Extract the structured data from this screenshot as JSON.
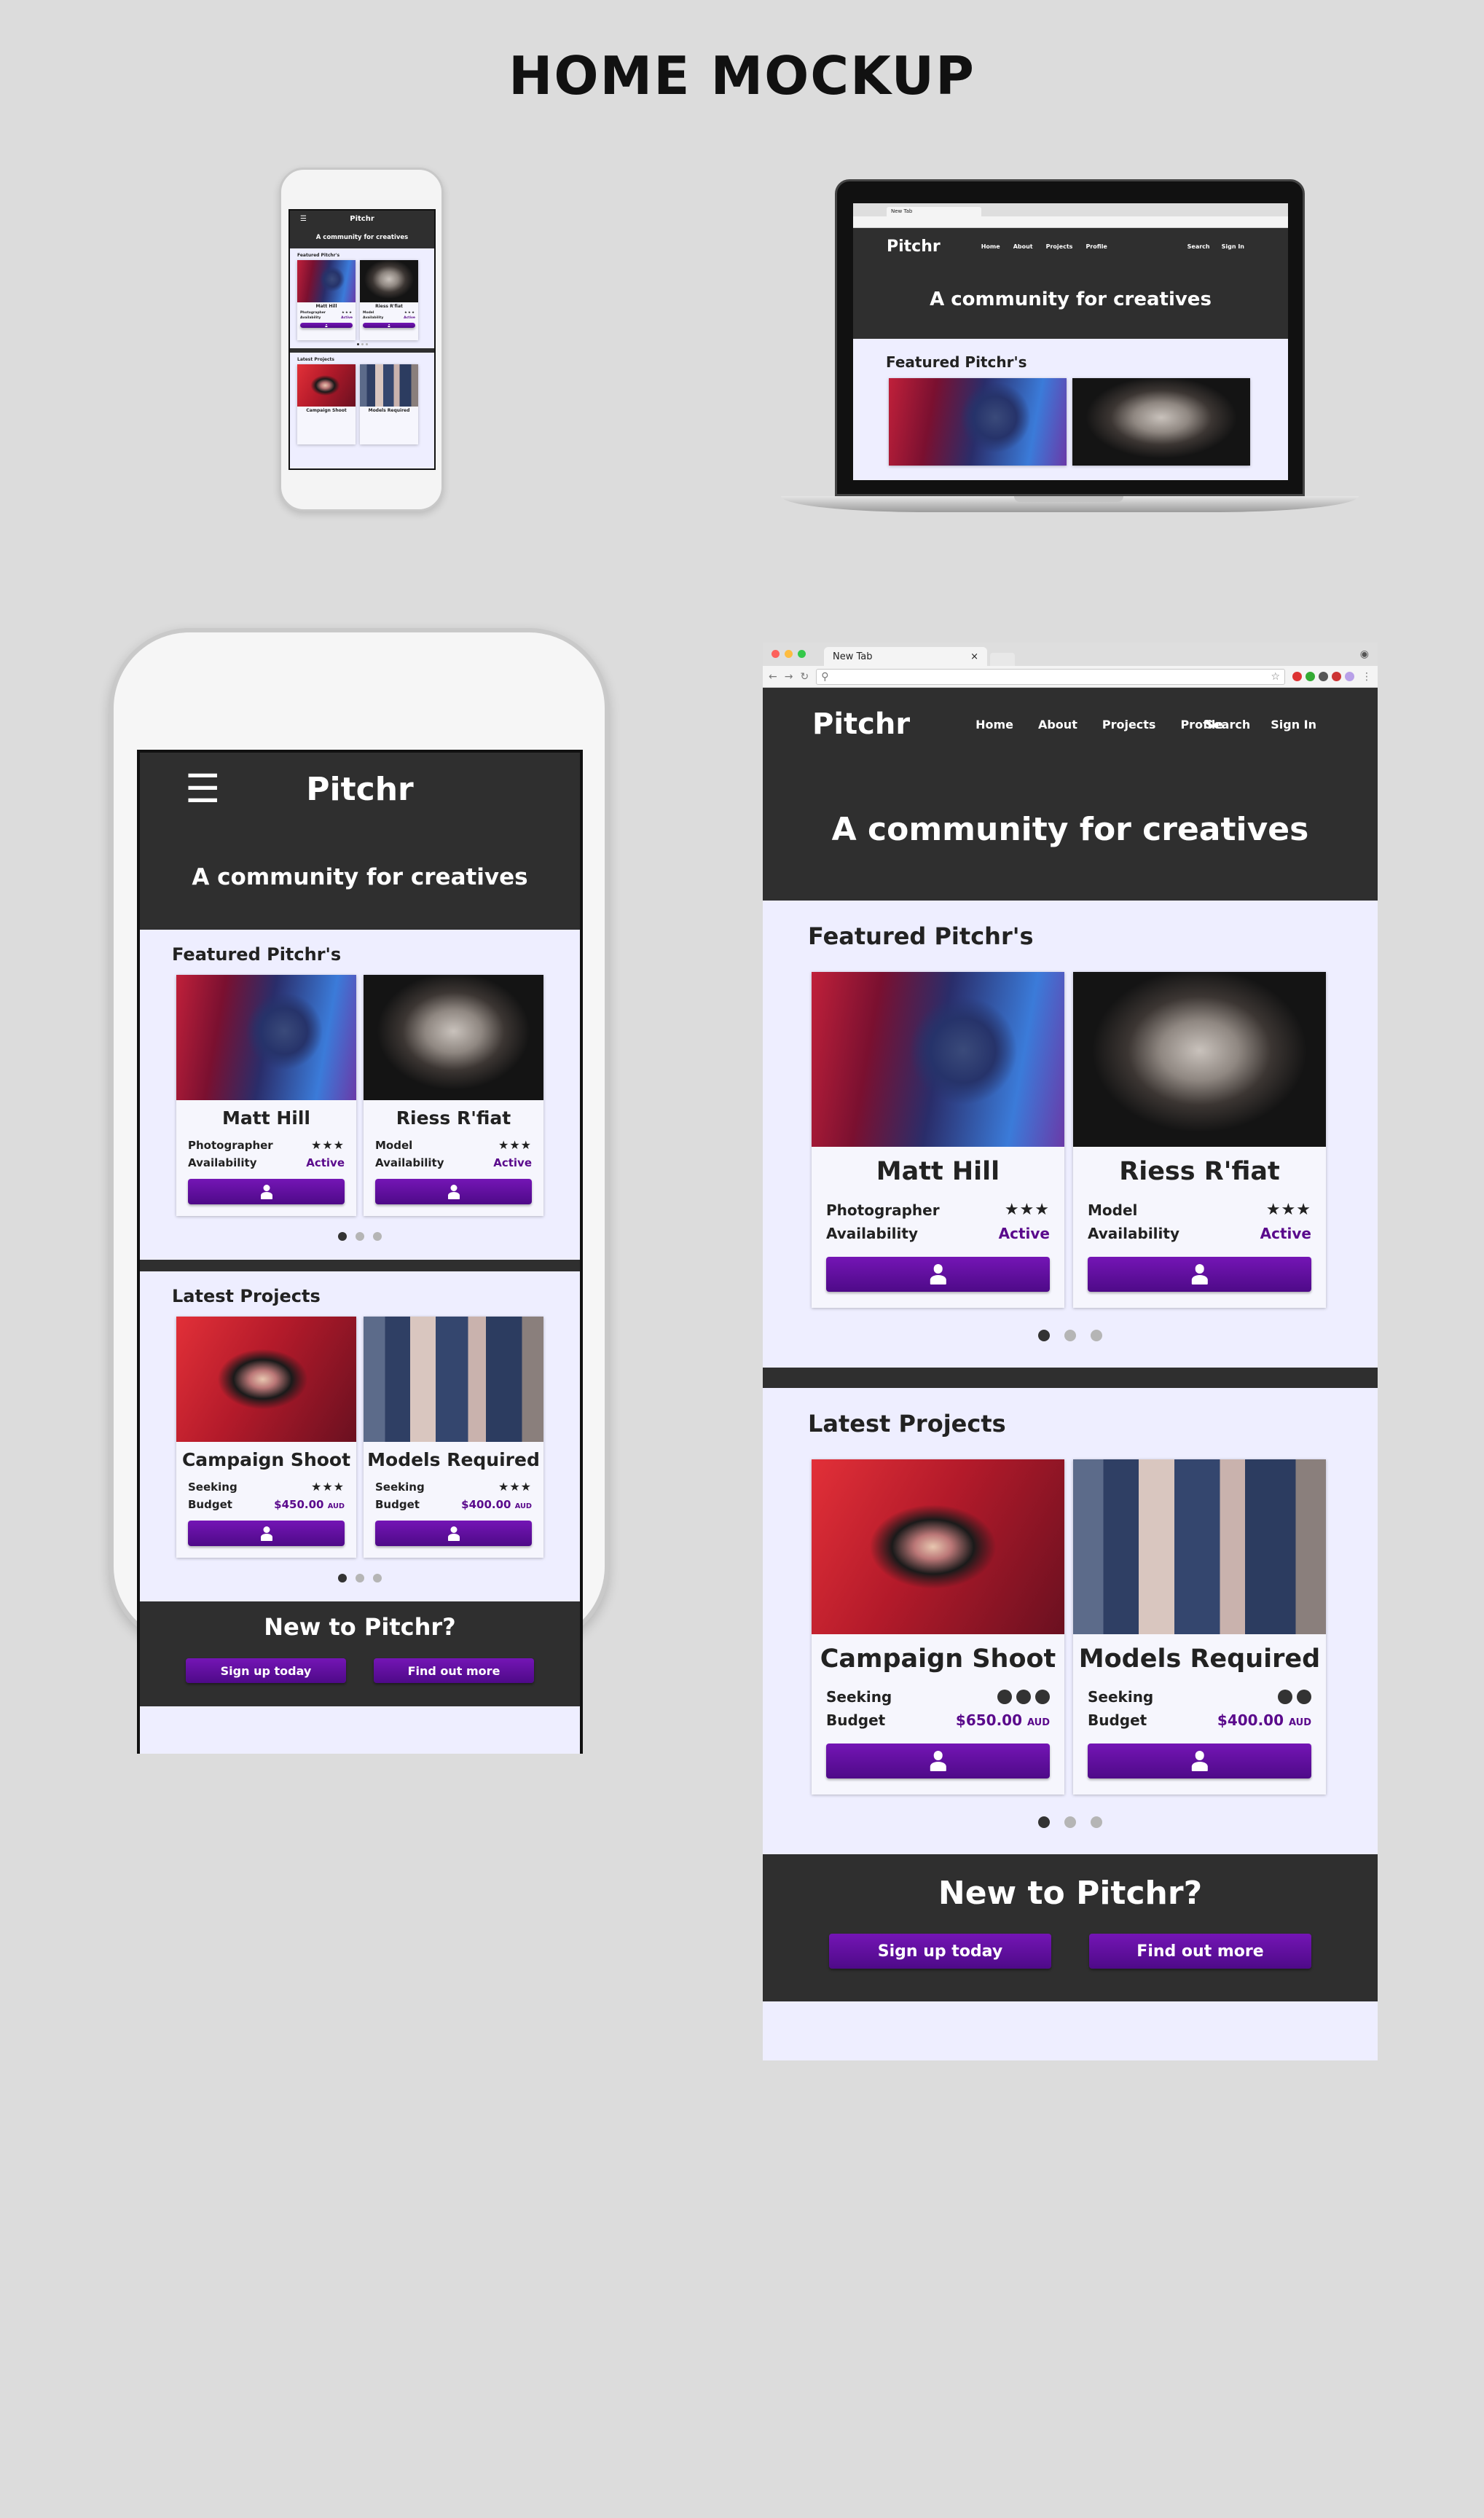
{
  "page_title": "HOME MOCKUP",
  "brand": "Pitchr",
  "nav": {
    "links": [
      "Home",
      "About",
      "Projects",
      "Profile"
    ],
    "search": "Search",
    "signin": "Sign In"
  },
  "hero_text": "A community for creatives",
  "featured": {
    "title": "Featured Pitchr's",
    "cards": [
      {
        "name": "Matt Hill",
        "role": "Photographer",
        "rating_stars": 3,
        "availability_label": "Availability",
        "availability": "Active"
      },
      {
        "name": "Riess R'fiat",
        "role": "Model",
        "rating_stars": 3,
        "availability_label": "Availability",
        "availability": "Active"
      }
    ]
  },
  "projects": {
    "title": "Latest Projects",
    "cards": [
      {
        "name": "Campaign Shoot",
        "seeking_label": "Seeking",
        "budget_label": "Budget",
        "budget_phone": "$450.00",
        "budget_browser": "$650.00",
        "currency": "AUD"
      },
      {
        "name": "Models Required",
        "seeking_label": "Seeking",
        "budget_label": "Budget",
        "budget_phone": "$400.00",
        "budget_browser": "$400.00",
        "currency": "AUD"
      }
    ]
  },
  "cta": {
    "title": "New to Pitchr?",
    "signup": "Sign up today",
    "findout": "Find out more"
  },
  "browser": {
    "tab_title": "New Tab",
    "tab_close": "×"
  },
  "colors": {
    "dark": "#2f2f2f",
    "accent_purple": "#5a0a8c",
    "page_bg": "#eeeeff",
    "mockup_bg": "#dcdcdc"
  },
  "carousel": {
    "dots": 3,
    "active_index": 0
  },
  "icons": {
    "menu": "hamburger-icon",
    "star": "star-icon",
    "profile": "user-icon"
  }
}
